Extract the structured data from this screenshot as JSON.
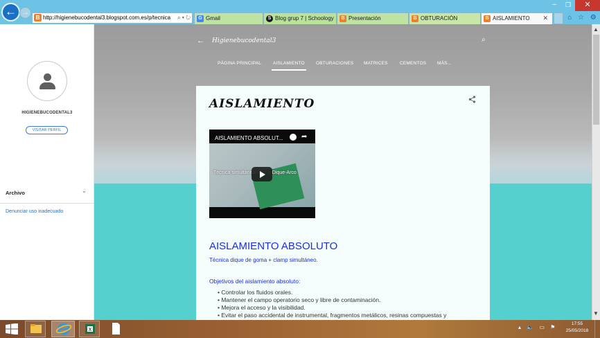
{
  "browser": {
    "address": "http://higienebucodental3.blogspot.com.es/p/tecnica",
    "address_controls": "⌕ ▾ ↻",
    "tabs": [
      {
        "label": "Gmail",
        "icon_letter": "G",
        "color": "#4285f4"
      },
      {
        "label": "Blog grup 7 | Schoology",
        "icon_letter": "S",
        "color": "#1a1a1a"
      },
      {
        "label": "Presentación",
        "icon_letter": "B",
        "color": "#f07d28"
      },
      {
        "label": "OBTURACIÓN",
        "icon_letter": "B",
        "color": "#f07d28"
      },
      {
        "label": "AISLAMIENTO",
        "icon_letter": "B",
        "color": "#f07d28"
      }
    ],
    "tab_close": "✕",
    "window_min": "–",
    "window_max": "❐",
    "window_close": "✕",
    "toolbar_icons": "⌂ ☆ ⚙"
  },
  "sidebar": {
    "profile_name": "HIGIENEBUCODENTAL3",
    "visit_profile": "VISITAR PERFIL",
    "archive_label": "Archivo",
    "archive_chevron": "⌄",
    "report_link": "Denunciar uso inadecuado"
  },
  "header": {
    "back_arrow": "←",
    "blog_title": "Higienebucodental3",
    "search_icon": "⌕",
    "nav": [
      "PÁGINA PRINCIPAL",
      "AISLAMIENTO",
      "OBTURACIONES",
      "MATRICES",
      "CEMENTOS",
      "MÁS..."
    ],
    "active_nav": "AISLAMIENTO"
  },
  "post": {
    "title": "AISLAMIENTO",
    "share_icon": "share-icon",
    "video": {
      "title": "AISLAMIENTO ABSOLUT...",
      "caption": "Técnica simultánea Clamp-Dique-Arco"
    },
    "heading": "AISLAMIENTO ABSOLUTO",
    "subheading": "Técnica dique de goma + clamp simultáneo.",
    "objectives_heading": "Objetivos del aislamiento absoluto:",
    "objectives": [
      "Controlar los fluidos orales.",
      "Mantener el campo operatorio seco y libre de contaminación.",
      "Mejora el acceso y la visibilidad.",
      "Evitar el paso accidental de instrumental, fragmentos metálicos, resinas compuestas y"
    ]
  },
  "taskbar": {
    "time": "17:55",
    "date": "25/05/2018",
    "tray_icons": "▴ 🔈 ▭ ⚑"
  },
  "colors": {
    "accent_blue": "#1a2ee0",
    "teal": "#55d0cf",
    "chrome_blue": "#6dc3e6"
  }
}
